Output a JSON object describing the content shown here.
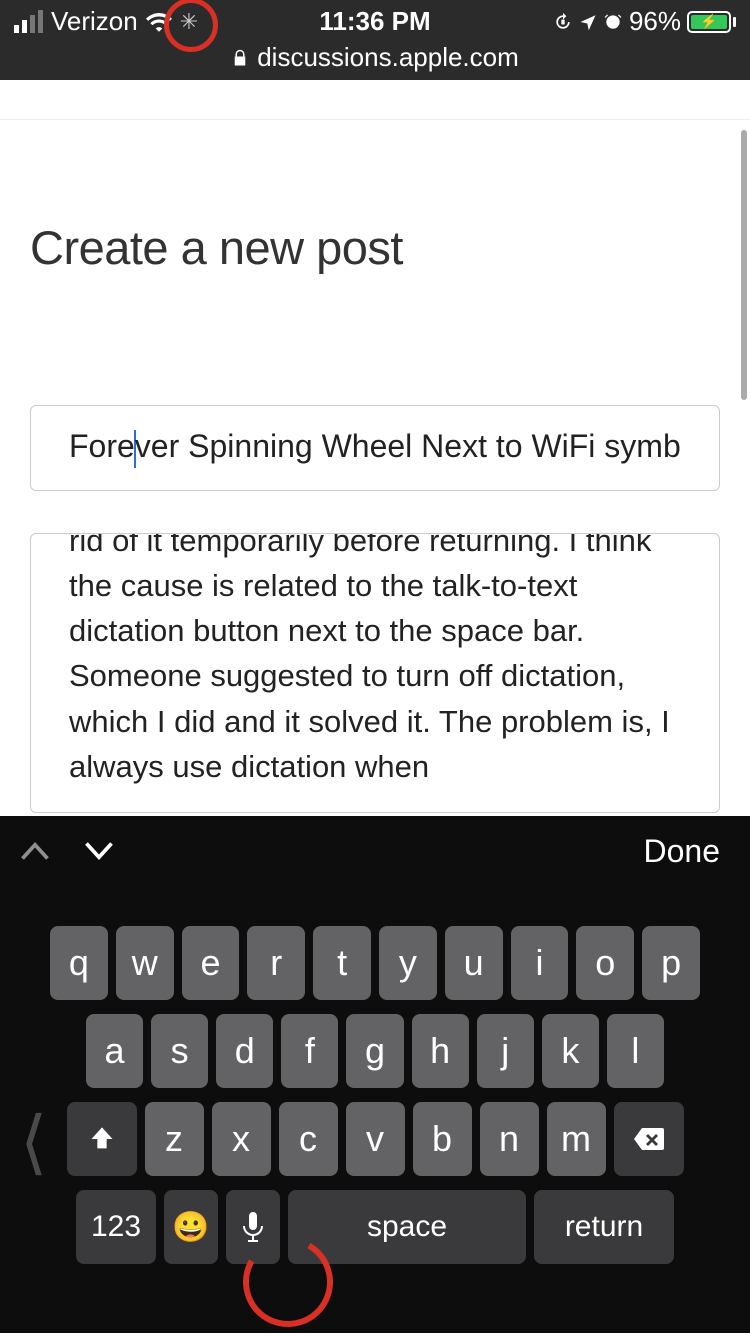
{
  "statusbar": {
    "carrier": "Verizon",
    "time": "11:36 PM",
    "battery_percent": "96%"
  },
  "browser": {
    "domain": "discussions.apple.com"
  },
  "page": {
    "heading": "Create a new post",
    "title_before_caret": "Fore",
    "title_after_caret": "ver Spinning Wheel Next to WiFi symb",
    "body_visible": "rid of it temporarily before returning. I think the cause is related to the talk-to-text dictation button next to the space bar. Someone suggested to turn off dictation, which I did and it solved it. The problem is, I always use dictation when"
  },
  "keyboard": {
    "done": "Done",
    "row1": [
      "q",
      "w",
      "e",
      "r",
      "t",
      "y",
      "u",
      "i",
      "o",
      "p"
    ],
    "row2": [
      "a",
      "s",
      "d",
      "f",
      "g",
      "h",
      "j",
      "k",
      "l"
    ],
    "row3": [
      "z",
      "x",
      "c",
      "v",
      "b",
      "n",
      "m"
    ],
    "numbers_label": "123",
    "space_label": "space",
    "return_label": "return"
  }
}
